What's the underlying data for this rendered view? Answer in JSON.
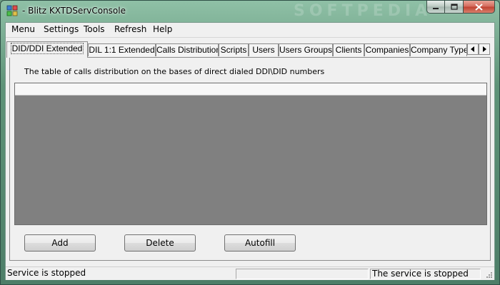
{
  "window": {
    "title": "- Blitz KXTDServConsole",
    "watermark": "SOFTPEDIA"
  },
  "menubar": {
    "items": [
      "Menu",
      "Settings",
      "Tools",
      "Refresh",
      "Help"
    ]
  },
  "tabs": {
    "items": [
      "DID/DDI Extended",
      "DIL 1:1 Extended",
      "Calls Distribution",
      "Scripts",
      "Users",
      "Users Groups",
      "Clients",
      "Companies",
      "Company Type"
    ],
    "active_index": 0
  },
  "panel": {
    "description": "The table of calls distribution on the bases of direct dialed DDI\\DID numbers",
    "buttons": {
      "add": "Add",
      "delete": "Delete",
      "autofill": "Autofill"
    }
  },
  "statusbar": {
    "left": "Service is stopped",
    "middle": "",
    "right": "The service is stopped"
  },
  "colors": {
    "grid_background": "#808080",
    "title_bar": "#5e9378",
    "close_button": "#c0402f"
  },
  "icons": [
    "app-icon",
    "minimize-icon",
    "maximize-icon",
    "close-icon",
    "scroll-left-icon",
    "scroll-right-icon",
    "size-grip-icon"
  ]
}
